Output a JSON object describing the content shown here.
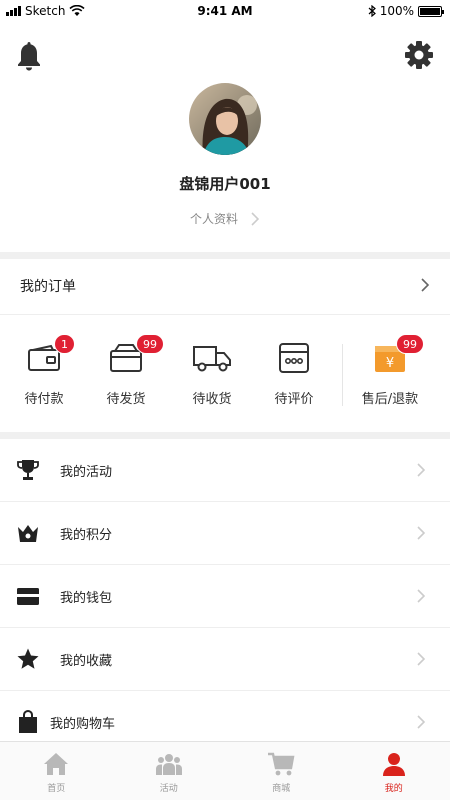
{
  "status_bar": {
    "carrier": "Sketch",
    "time": "9:41 AM",
    "battery": "100%"
  },
  "header": {
    "bell_icon": "bell-icon",
    "settings_icon": "gear-icon",
    "username": "盘锦用户001",
    "profile_link": "个人资料"
  },
  "orders": {
    "title": "我的订单",
    "items": [
      {
        "label": "待付款",
        "icon": "wallet-icon",
        "badge": "1"
      },
      {
        "label": "待发货",
        "icon": "package-icon",
        "badge": "99"
      },
      {
        "label": "待收货",
        "icon": "truck-icon",
        "badge": ""
      },
      {
        "label": "待评价",
        "icon": "comment-icon",
        "badge": ""
      },
      {
        "label": "售后/退款",
        "icon": "refund-icon",
        "badge": "99"
      }
    ]
  },
  "menu": [
    {
      "label": "我的活动",
      "icon": "trophy-icon"
    },
    {
      "label": "我的积分",
      "icon": "crown-icon"
    },
    {
      "label": "我的钱包",
      "icon": "card-icon"
    },
    {
      "label": "我的收藏",
      "icon": "star-icon"
    },
    {
      "label": "我的购物车",
      "icon": "bag-icon"
    }
  ],
  "tabbar": [
    {
      "label": "首页",
      "icon": "home-icon",
      "active": false
    },
    {
      "label": "活动",
      "icon": "people-icon",
      "active": false
    },
    {
      "label": "商城",
      "icon": "cart-icon",
      "active": false
    },
    {
      "label": "我的",
      "icon": "user-icon",
      "active": true
    }
  ],
  "colors": {
    "accent": "#d9231c",
    "badge": "#e02033",
    "refund_orange": "#f39a2c"
  }
}
